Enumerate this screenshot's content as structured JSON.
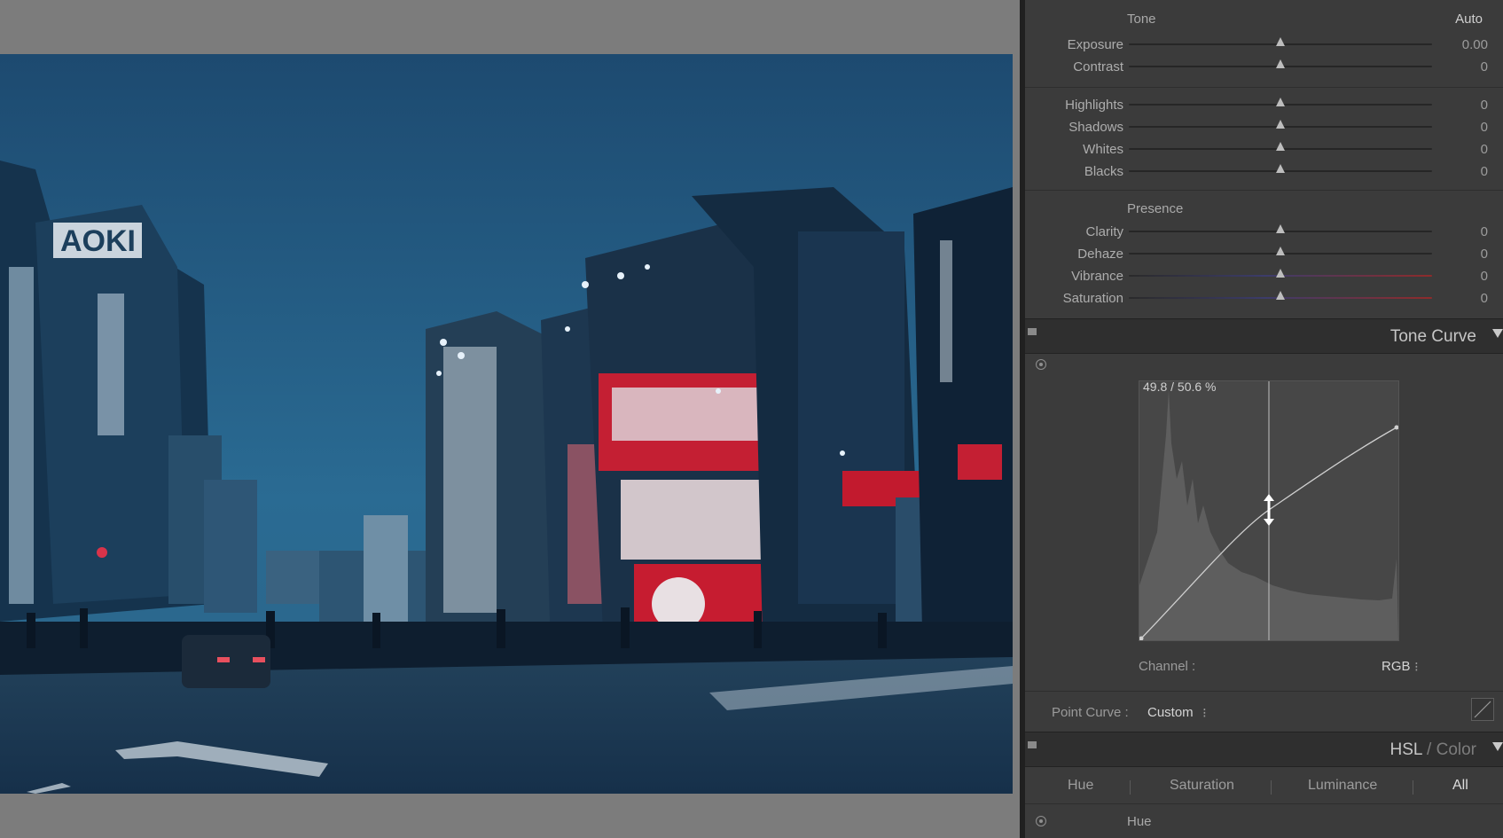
{
  "tone": {
    "section_label": "Tone",
    "auto_label": "Auto",
    "sliders": [
      {
        "label": "Exposure",
        "value": "0.00"
      },
      {
        "label": "Contrast",
        "value": "0"
      }
    ]
  },
  "tone_detail": {
    "sliders": [
      {
        "label": "Highlights",
        "value": "0"
      },
      {
        "label": "Shadows",
        "value": "0"
      },
      {
        "label": "Whites",
        "value": "0"
      },
      {
        "label": "Blacks",
        "value": "0"
      }
    ]
  },
  "presence": {
    "section_label": "Presence",
    "sliders": [
      {
        "label": "Clarity",
        "value": "0"
      },
      {
        "label": "Dehaze",
        "value": "0"
      },
      {
        "label": "Vibrance",
        "value": "0"
      },
      {
        "label": "Saturation",
        "value": "0"
      }
    ]
  },
  "tone_curve": {
    "title": "Tone Curve",
    "readout": "49.8 / 50.6 %",
    "channel_label": "Channel :",
    "channel_value": "RGB",
    "point_curve_label": "Point Curve :",
    "point_curve_value": "Custom"
  },
  "hsl": {
    "title_main": "HSL",
    "title_sep": " / ",
    "title_alt": "Color",
    "tabs": [
      "Hue",
      "Saturation",
      "Luminance",
      "All"
    ],
    "active_tab": "All",
    "sub_label": "Hue"
  },
  "photo_sign": {
    "aoki": "AOKI"
  },
  "colors": {
    "panel_bg": "#3b3b3b",
    "header_bg": "#2f2f2f",
    "canvas_bg": "#7c7c7c",
    "sky_top": "#1e4d72",
    "sky_bottom": "#2b6a92",
    "sign_red": "#c9182b"
  },
  "icons": [
    "target-adjust-icon",
    "collapse-triangle-icon",
    "panel-switch-icon",
    "point-curve-icon",
    "vertical-resize-cursor-icon"
  ]
}
